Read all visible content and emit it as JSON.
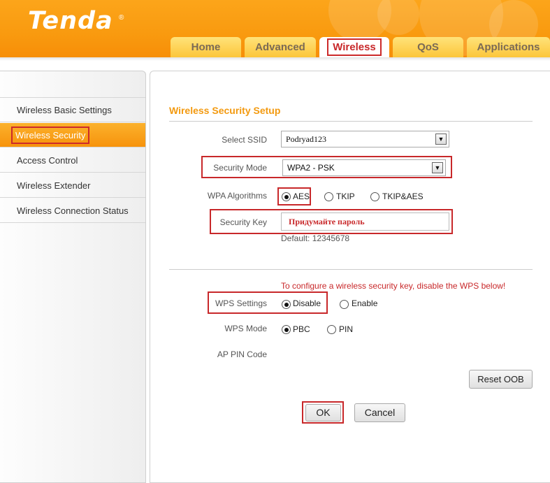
{
  "brand": {
    "logo_text": "Tenda",
    "reg_mark": "®"
  },
  "tabs": [
    {
      "label": "Home"
    },
    {
      "label": "Advanced"
    },
    {
      "label": "Wireless"
    },
    {
      "label": "QoS"
    },
    {
      "label": "Applications"
    }
  ],
  "active_tab": "Wireless",
  "sidebar": {
    "items": [
      {
        "label": "Wireless Basic Settings"
      },
      {
        "label": "Wireless Security"
      },
      {
        "label": "Access Control"
      },
      {
        "label": "Wireless Extender"
      },
      {
        "label": "Wireless Connection Status"
      }
    ],
    "active_item": "Wireless Security"
  },
  "form": {
    "title": "Wireless Security Setup",
    "ssid": {
      "label": "Select SSID",
      "value": "Podryad123"
    },
    "security_mode": {
      "label": "Security Mode",
      "value": "WPA2 - PSK"
    },
    "wpa_algorithms": {
      "label": "WPA Algorithms",
      "options": [
        "AES",
        "TKIP",
        "TKIP&AES"
      ],
      "selected": "AES"
    },
    "security_key": {
      "label": "Security Key",
      "value": "Придумайте пароль",
      "default_note": "Default: 12345678"
    },
    "wps_warning": "To configure a wireless security key, disable the WPS below!",
    "wps_settings": {
      "label": "WPS Settings",
      "options": [
        "Disable",
        "Enable"
      ],
      "selected": "Disable"
    },
    "wps_mode": {
      "label": "WPS Mode",
      "options": [
        "PBC",
        "PIN"
      ],
      "selected": "PBC"
    },
    "ap_pin": {
      "label": "AP PIN Code"
    },
    "reset_oob_label": "Reset OOB",
    "ok_label": "OK",
    "cancel_label": "Cancel"
  },
  "colors": {
    "brand_orange": "#f99a0f",
    "highlight_red": "#c8282a",
    "title_orange": "#f39a10"
  }
}
